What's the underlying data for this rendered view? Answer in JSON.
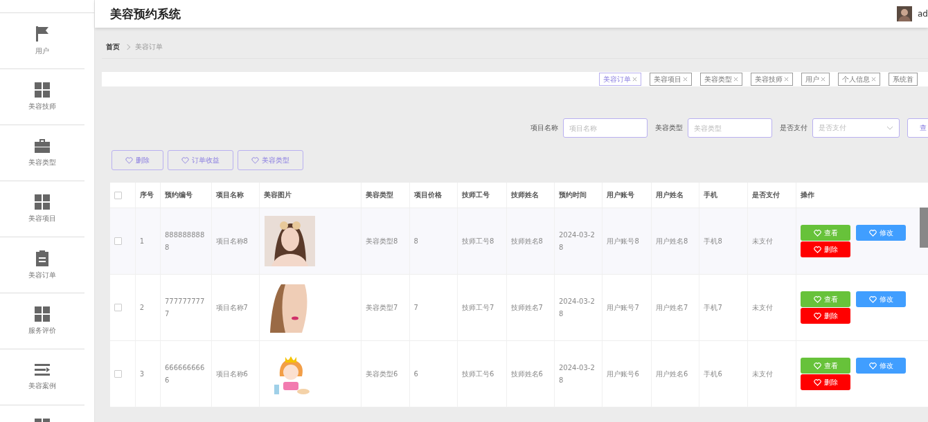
{
  "sidebar": {
    "items": [
      {
        "label": "用户",
        "kind": "flag"
      },
      {
        "label": "美容技师",
        "kind": "grid"
      },
      {
        "label": "美容类型",
        "kind": "briefcase"
      },
      {
        "label": "美容项目",
        "kind": "grid"
      },
      {
        "label": "美容订单",
        "kind": "clipboard"
      },
      {
        "label": "服务评价",
        "kind": "grid"
      },
      {
        "label": "美容案例",
        "kind": "list"
      },
      {
        "kind": "grid"
      }
    ]
  },
  "header": {
    "title": "美容预约系统",
    "user": "ad"
  },
  "breadcrumb": [
    "首页",
    "美容订单"
  ],
  "tags": [
    {
      "label": "美容订单",
      "selected": true
    },
    {
      "label": "美容项目",
      "selected": false
    },
    {
      "label": "美容类型",
      "selected": false
    },
    {
      "label": "美容技师",
      "selected": false
    },
    {
      "label": "用户",
      "selected": false
    },
    {
      "label": "个人信息",
      "selected": false
    },
    {
      "label": "系统首",
      "selected": false
    }
  ],
  "search": {
    "fields": [
      {
        "label": "项目名称",
        "placeholder": "项目名称",
        "kind": "input"
      },
      {
        "label": "美容类型",
        "placeholder": "美容类型",
        "kind": "input"
      },
      {
        "label": "是否支付",
        "placeholder": "是否支付",
        "kind": "select"
      }
    ],
    "button": "查"
  },
  "actions": [
    "删除",
    "订单收益",
    "美容类型"
  ],
  "table": {
    "all_checked": false,
    "columns": [
      "序号",
      "预约编号",
      "项目名称",
      "美容图片",
      "美容类型",
      "项目价格",
      "技师工号",
      "技师姓名",
      "预约时间",
      "用户账号",
      "用户姓名",
      "手机",
      "是否支付",
      "操作"
    ],
    "rows": [
      {
        "checked": false,
        "cells": [
          "1",
          "8888888888",
          "项目名称8",
          "",
          "美容类型8",
          "8",
          "技师工号8",
          "技师姓名8",
          "2024-03-28",
          "用户账号8",
          "用户姓名8",
          "手机8",
          "未支付"
        ],
        "buttons": [
          {
            "label": "查看",
            "kind": "view"
          },
          {
            "label": "修改",
            "kind": "edit"
          },
          {
            "label": "删除",
            "kind": "delete"
          }
        ]
      },
      {
        "checked": false,
        "cells": [
          "2",
          "7777777777",
          "项目名称7",
          "",
          "美容类型7",
          "7",
          "技师工号7",
          "技师姓名7",
          "2024-03-28",
          "用户账号7",
          "用户姓名7",
          "手机7",
          "未支付"
        ],
        "buttons": [
          {
            "label": "查看",
            "kind": "view"
          },
          {
            "label": "修改",
            "kind": "edit"
          },
          {
            "label": "删除",
            "kind": "delete"
          }
        ]
      },
      {
        "checked": false,
        "cells": [
          "3",
          "6666666666",
          "项目名称6",
          "",
          "美容类型6",
          "6",
          "技师工号6",
          "技师姓名6",
          "2024-03-28",
          "用户账号6",
          "用户姓名6",
          "手机6",
          "未支付"
        ],
        "buttons": [
          {
            "label": "查看",
            "kind": "view"
          },
          {
            "label": "修改",
            "kind": "edit"
          },
          {
            "label": "删除",
            "kind": "delete"
          }
        ]
      }
    ]
  }
}
